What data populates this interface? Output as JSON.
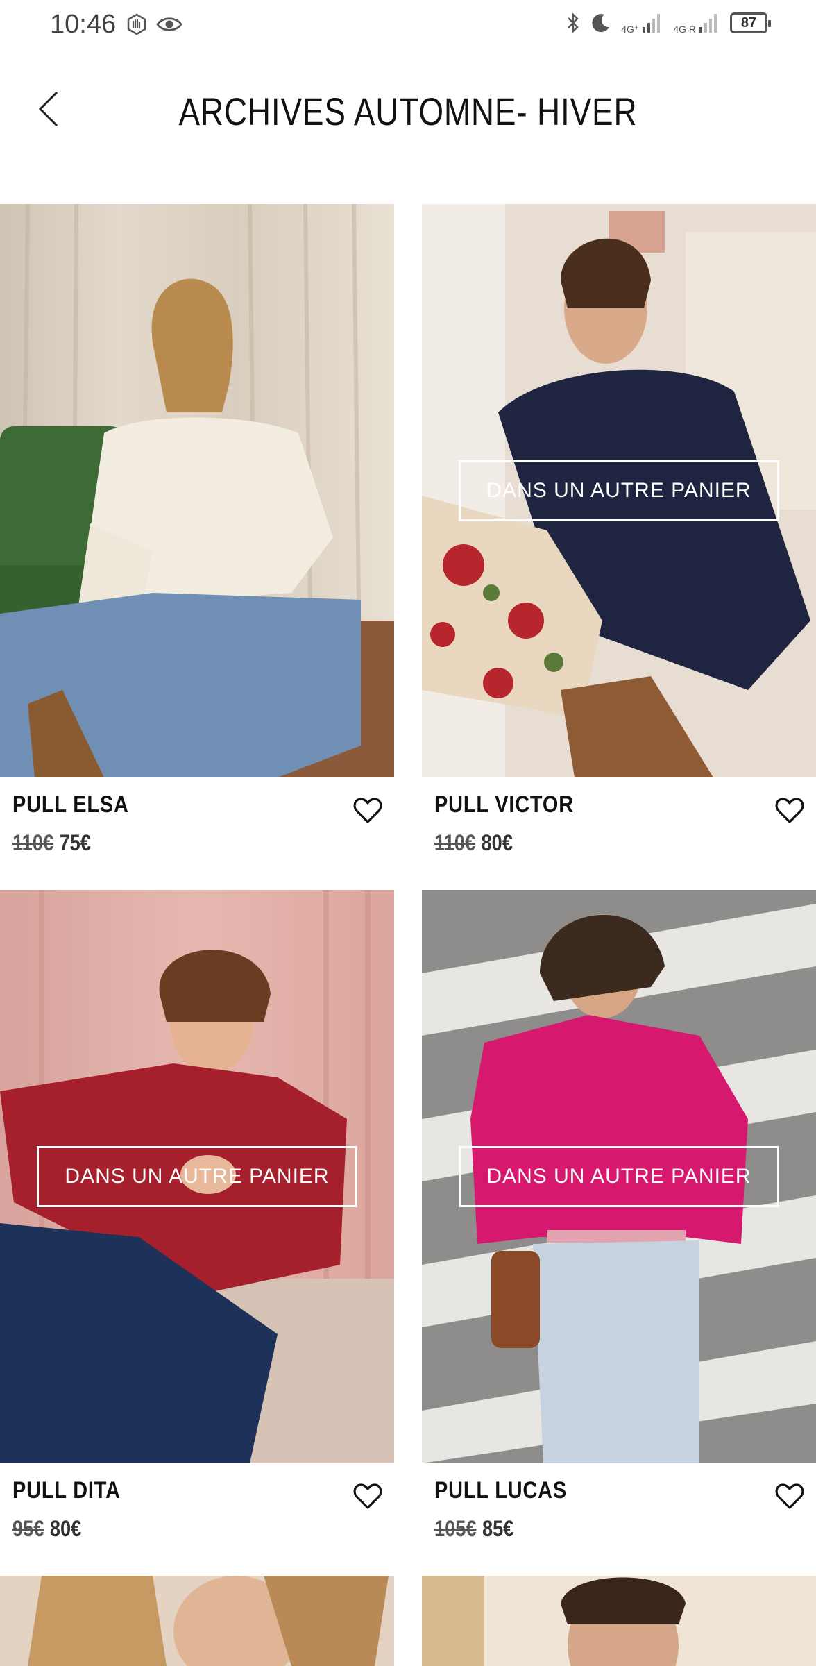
{
  "status_bar": {
    "time": "10:46",
    "network_1": "4G⁺",
    "network_2": "4G R",
    "battery": "87"
  },
  "header": {
    "title": "ARCHIVES AUTOMNE- HIVER",
    "back_icon": "chevron-left-icon"
  },
  "products": [
    {
      "name": "PULL ELSA",
      "old_price": "110€",
      "price": "75€",
      "cart_label": ""
    },
    {
      "name": "PULL VICTOR",
      "old_price": "110€",
      "price": "80€",
      "cart_label": "DANS UN AUTRE PANIER"
    },
    {
      "name": "PULL DITA",
      "old_price": "95€",
      "price": "80€",
      "cart_label": "DANS UN AUTRE PANIER"
    },
    {
      "name": "PULL LUCAS",
      "old_price": "105€",
      "price": "85€",
      "cart_label": "DANS UN AUTRE PANIER"
    }
  ],
  "colors": {
    "background": "#ffffff",
    "text": "#111111",
    "overlay_text": "#ffffff"
  }
}
